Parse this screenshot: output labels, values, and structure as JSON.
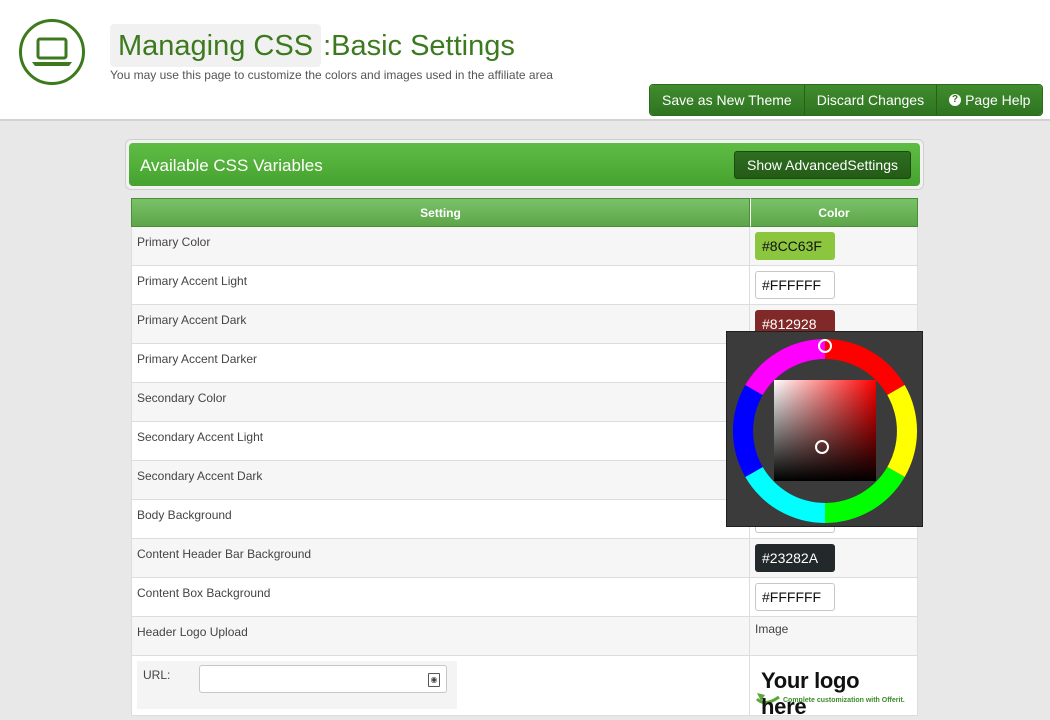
{
  "header": {
    "title_main": "Managing CSS",
    "title_sub": ":Basic Settings",
    "subtitle": "You may use this page to customize the colors and images used in the affiliate area",
    "logo_icon": "laptop-icon"
  },
  "toolbar": {
    "save_theme": "Save as New Theme",
    "discard": "Discard Changes",
    "help": "Page Help",
    "help_icon": "?"
  },
  "panel": {
    "title": "Available CSS Variables",
    "advanced_button": "Show AdvancedSettings"
  },
  "table": {
    "headers": {
      "setting": "Setting",
      "color": "Color"
    },
    "rows": [
      {
        "label": "Primary Color",
        "value": "#8CC63F",
        "swatch": "#8cc63f"
      },
      {
        "label": "Primary Accent Light",
        "value": "#FFFFFF",
        "swatch": "#ffffff"
      },
      {
        "label": "Primary Accent Dark",
        "value": "#812928",
        "swatch": "#812928"
      },
      {
        "label": "Primary Accent Darker",
        "value": "",
        "swatch": "#ffffff"
      },
      {
        "label": "Secondary Color",
        "value": "",
        "swatch": "#ffffff"
      },
      {
        "label": "Secondary Accent Light",
        "value": "",
        "swatch": "#ffffff"
      },
      {
        "label": "Secondary Accent Dark",
        "value": "",
        "swatch": "#ffffff"
      },
      {
        "label": "Body Background",
        "value": "",
        "swatch": "#ffffff"
      },
      {
        "label": "Content Header Bar Background",
        "value": "#23282A",
        "swatch": "#23282a"
      },
      {
        "label": "Content Box Background",
        "value": "#FFFFFF",
        "swatch": "#ffffff"
      }
    ],
    "logo_row": {
      "label": "Header Logo Upload",
      "type_label": "Image"
    },
    "url_label": "URL:",
    "logo_preview": {
      "headline": "Your logo here",
      "tagline": "Complete customization with Offerit."
    }
  },
  "colors": {
    "brand_green": "#3d7a1f",
    "bar_green": "#4fab37",
    "picker_bg": "#3b3b3b"
  }
}
